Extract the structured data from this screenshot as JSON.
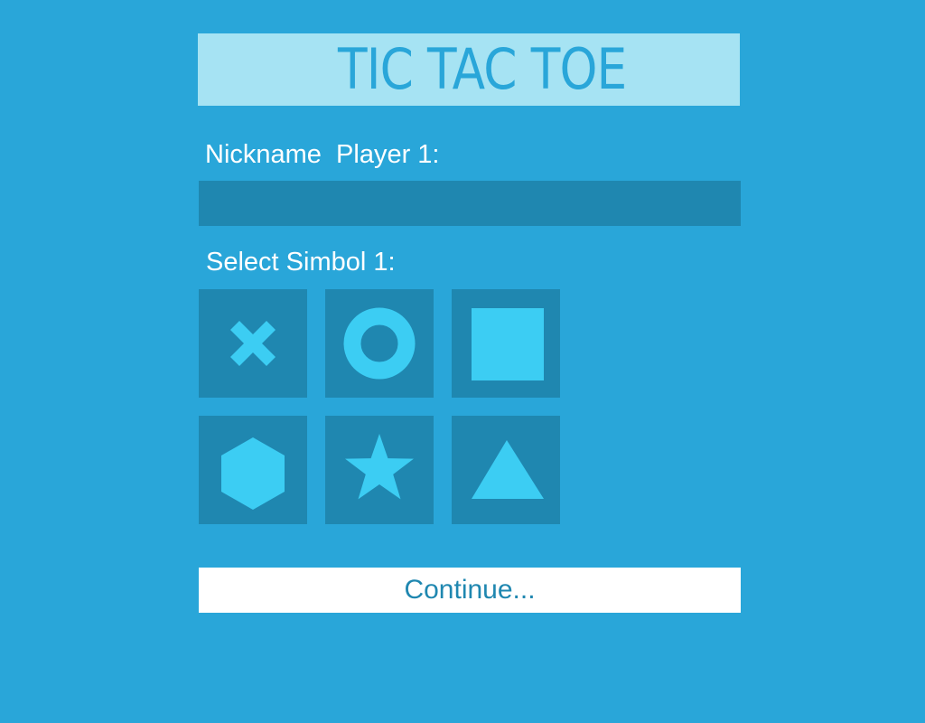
{
  "title": "TIC TAC TOE",
  "nickname": {
    "label": "Nickname  Player 1:",
    "value": "",
    "placeholder": ""
  },
  "symbols": {
    "label": "Select Simbol 1:",
    "items": [
      {
        "name": "x",
        "icon": "x-icon"
      },
      {
        "name": "circle",
        "icon": "circle-icon"
      },
      {
        "name": "square",
        "icon": "square-icon"
      },
      {
        "name": "hexagon",
        "icon": "hexagon-icon"
      },
      {
        "name": "star",
        "icon": "star-icon"
      },
      {
        "name": "triangle",
        "icon": "triangle-icon"
      }
    ]
  },
  "continue_label": "Continue...",
  "colors": {
    "background": "#29a6d9",
    "banner": "#a6e3f3",
    "tile": "#1f87b0",
    "symbol": "#3ccdf3",
    "button": "#ffffff",
    "button_text": "#1f87b0"
  }
}
